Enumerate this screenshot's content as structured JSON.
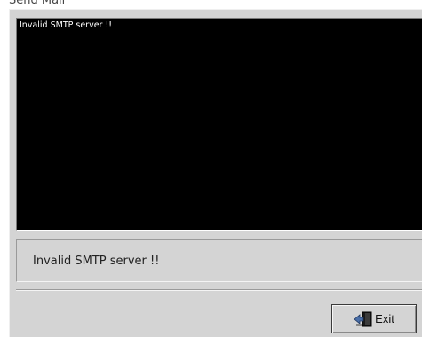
{
  "window": {
    "title_fragment": "Send Mail"
  },
  "console": {
    "output_text": "Invalid SMTP server !!"
  },
  "status": {
    "message": "Invalid SMTP server !!"
  },
  "actions": {
    "exit_label": "Exit",
    "exit_icon": "exit-door-icon"
  },
  "colors": {
    "console_background": "#000000",
    "console_text": "#ffffff",
    "panel_background": "#d4d4d4"
  }
}
